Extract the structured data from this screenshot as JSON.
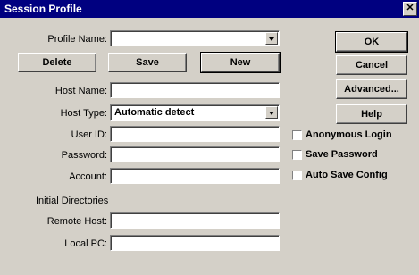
{
  "title": "Session Profile",
  "close_glyph": "✕",
  "labels": {
    "profile_name": "Profile Name:",
    "host_name": "Host Name:",
    "host_type": "Host Type:",
    "user_id": "User ID:",
    "password": "Password:",
    "account": "Account:",
    "initial_directories": "Initial Directories",
    "remote_host": "Remote Host:",
    "local_pc": "Local PC:"
  },
  "host_type_value": "Automatic detect",
  "buttons": {
    "delete": "Delete",
    "save": "Save",
    "new": "New",
    "ok": "OK",
    "cancel": "Cancel",
    "advanced": "Advanced...",
    "help": "Help"
  },
  "checkboxes": {
    "anonymous_login": "Anonymous Login",
    "save_password": "Save Password",
    "auto_save_config": "Auto Save Config"
  }
}
